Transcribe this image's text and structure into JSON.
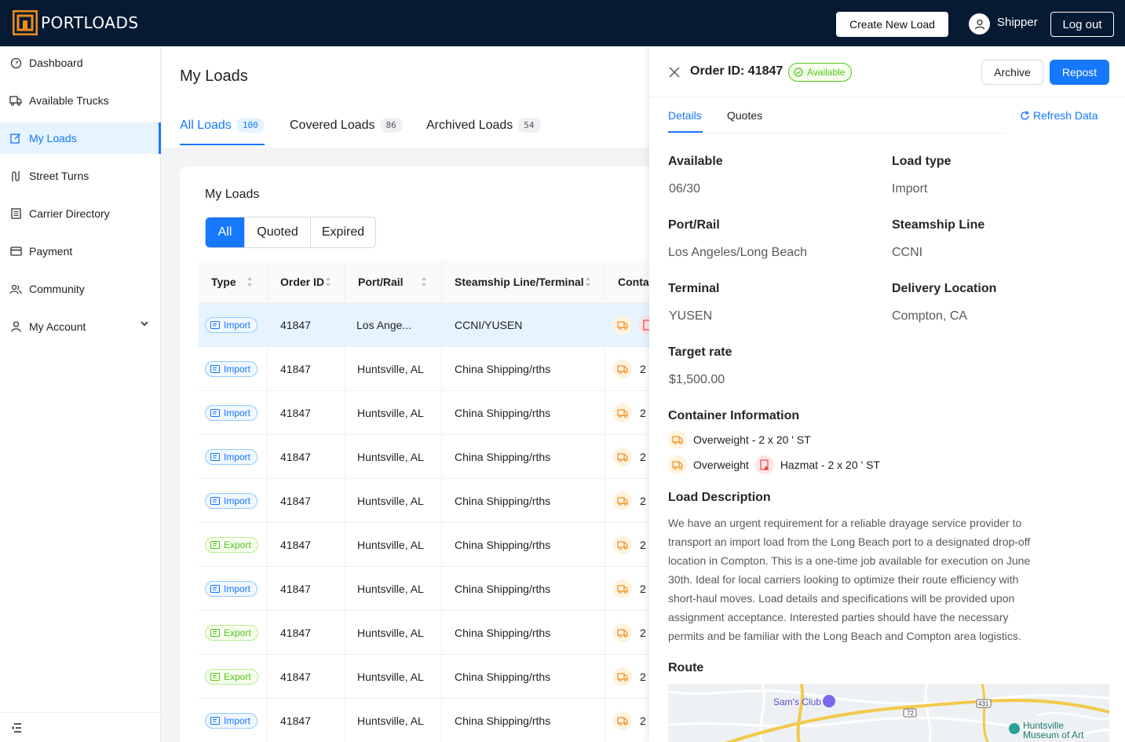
{
  "header": {
    "logo_text": "PORTLOADS",
    "create_label": "Create New Load",
    "user_name": "Shipper",
    "logout_label": "Log out"
  },
  "sidebar": {
    "items": [
      {
        "label": "Dashboard",
        "icon": "dashboard-icon"
      },
      {
        "label": "Available Trucks",
        "icon": "truck-icon"
      },
      {
        "label": "My Loads",
        "icon": "edit-icon"
      },
      {
        "label": "Street Turns",
        "icon": "route-icon"
      },
      {
        "label": "Carrier Directory",
        "icon": "directory-icon"
      },
      {
        "label": "Payment",
        "icon": "credit-card-icon"
      },
      {
        "label": "Community",
        "icon": "community-icon"
      },
      {
        "label": "My Account",
        "icon": "user-icon"
      }
    ],
    "active_index": 2
  },
  "main": {
    "title": "My Loads",
    "tabs": [
      {
        "label": "All Loads",
        "count": "100"
      },
      {
        "label": "Covered Loads",
        "count": "86"
      },
      {
        "label": "Archived Loads",
        "count": "54"
      }
    ],
    "card_title": "My Loads",
    "filters": [
      "All",
      "Quoted",
      "Expired"
    ],
    "columns": [
      "Type",
      "Order ID",
      "Port/Rail",
      "Steamship Line/Terminal",
      "Contai"
    ],
    "rows": [
      {
        "type": "Import",
        "order": "41847",
        "port": "Los Ange...",
        "line": "CCNI/YUSEN",
        "cont": ""
      },
      {
        "type": "Import",
        "order": "41847",
        "port": "Huntsville, AL",
        "line": "China Shipping/rths",
        "cont": "2"
      },
      {
        "type": "Import",
        "order": "41847",
        "port": "Huntsville, AL",
        "line": "China Shipping/rths",
        "cont": "2"
      },
      {
        "type": "Import",
        "order": "41847",
        "port": "Huntsville, AL",
        "line": "China Shipping/rths",
        "cont": "2"
      },
      {
        "type": "Import",
        "order": "41847",
        "port": "Huntsville, AL",
        "line": "China Shipping/rths",
        "cont": "2"
      },
      {
        "type": "Export",
        "order": "41847",
        "port": "Huntsville, AL",
        "line": "China Shipping/rths",
        "cont": "2"
      },
      {
        "type": "Import",
        "order": "41847",
        "port": "Huntsville, AL",
        "line": "China Shipping/rths",
        "cont": "2"
      },
      {
        "type": "Export",
        "order": "41847",
        "port": "Huntsville, AL",
        "line": "China Shipping/rths",
        "cont": "2"
      },
      {
        "type": "Export",
        "order": "41847",
        "port": "Huntsville, AL",
        "line": "China Shipping/rths",
        "cont": "2"
      },
      {
        "type": "Import",
        "order": "41847",
        "port": "Huntsville, AL",
        "line": "China Shipping/rths",
        "cont": "2"
      }
    ]
  },
  "panel": {
    "order_id": "Order ID: 41847",
    "status": "Available",
    "archive_label": "Archive",
    "repost_label": "Repost",
    "tabs": [
      "Details",
      "Quotes"
    ],
    "refresh_label": "Refresh Data",
    "fields": {
      "available_label": "Available",
      "available_value": "06/30",
      "load_type_label": "Load type",
      "load_type_value": "Import",
      "port_label": "Port/Rail",
      "port_value": "Los Angeles/Long Beach",
      "line_label": "Steamship Line",
      "line_value": "CCNI",
      "terminal_label": "Terminal",
      "terminal_value": "YUSEN",
      "delivery_label": "Delivery Location",
      "delivery_value": "Compton, CA",
      "rate_label": "Target rate",
      "rate_value": "$1,500.00"
    },
    "container_title": "Container Information",
    "container_line1": "Overweight - 2 x 20 ' ST",
    "container_line2a": "Overweight",
    "container_line2b": "Hazmat - 2 x 20 ' ST",
    "desc_title": "Load Description",
    "description": "We have an urgent requirement for a reliable drayage service provider to transport an import load from the Long Beach port to a designated drop-off location in Compton. This is a one-time job available for execution on June 30th. Ideal for local carriers looking to optimize their route efficiency with short-haul moves. Load details and specifications will be provided upon assignment acceptance. Interested parties should have the necessary permits and be familiar with the Long Beach and Compton area logistics.",
    "route_title": "Route",
    "map_labels": {
      "sams": "Sam's Club",
      "museum1": "Huntsville",
      "museum2": "Museum of Art",
      "r72": "72",
      "r431": "431"
    }
  },
  "colors": {
    "brand_orange": "#f08c1c",
    "header_bg": "#061a33",
    "accent": "#1677ff",
    "success": "#52c41a",
    "hazmat": "#e5484d"
  }
}
